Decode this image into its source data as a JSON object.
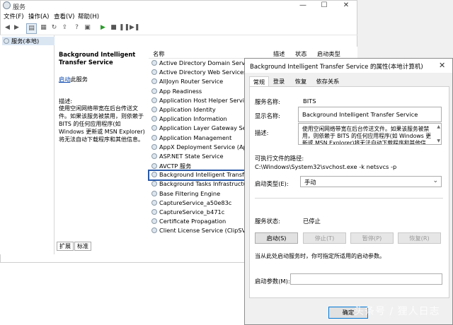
{
  "main_window": {
    "title": "服务",
    "menu": [
      "文件(F)",
      "操作(A)",
      "查看(V)",
      "帮助(H)"
    ],
    "tree_item": "服务(本地)",
    "selected_service_name": "Background Intelligent Transfer Service",
    "start_link": "启动",
    "start_link_suffix": "此服务",
    "desc_heading": "描述:",
    "desc_text": "使用空闲网络带宽在后台传送文件。如果该服务被禁用，则依赖于 BITS 的任何应用程序(如 Windows 更新或 MSN Explorer)将无法自动下载程序和其他信息。",
    "columns": [
      "名称",
      "描述",
      "状态",
      "启动类型"
    ],
    "services": [
      "Active Directory Domain Services",
      "Active Directory Web Services",
      "AllJoyn Router Service",
      "App Readiness",
      "Application Host Helper Service",
      "Application Identity",
      "Application Information",
      "Application Layer Gateway Servi",
      "Application Management",
      "AppX Deployment Service (AppX",
      "ASP.NET State Service",
      "AVCTP 服务",
      "Background Intelligent Transfer",
      "Background Tasks Infrastructure",
      "Base Filtering Engine",
      "CaptureService_a50e83c",
      "CaptureService_b471c",
      "Certificate Propagation",
      "Client License Service (ClipSVC)"
    ],
    "bottom_tabs": [
      "扩展",
      "标准"
    ]
  },
  "dialog": {
    "title": "Background Intelligent Transfer Service 的属性(本地计算机)",
    "close_glyph": "✕",
    "tabs": [
      "常规",
      "登录",
      "恢复",
      "依存关系"
    ],
    "service_name_label": "服务名称:",
    "service_name_value": "BITS",
    "display_name_label": "显示名称:",
    "display_name_value": "Background Intelligent Transfer Service",
    "description_label": "描述:",
    "description_value": "使用空闲网络带宽在后台传送文件。如果该服务被禁用，则依赖于 BITS 的任何应用程序(如 Windows 更新或 MSN Explorer)将无法自动下载程序和其他信息。",
    "exe_path_label": "可执行文件的路径:",
    "exe_path_value": "C:\\Windows\\System32\\svchost.exe -k netsvcs -p",
    "startup_type_label": "启动类型(E):",
    "startup_type_value": "手动",
    "service_status_label": "服务状态:",
    "service_status_value": "已停止",
    "buttons": {
      "start": "启动(S)",
      "stop": "停止(T)",
      "pause": "暂停(P)",
      "resume": "恢复(R)"
    },
    "hint_text": "当从此处启动服务时，你可指定所适用的启动参数。",
    "start_params_label": "启动参数(M):",
    "start_params_value": "",
    "ok_button": "确定"
  },
  "watermark": "头条号 / 狸人日志",
  "colors": {
    "highlight_border": "#2a5aa8",
    "link": "#0645ad",
    "dialog_bg": "#f0f0f0"
  }
}
